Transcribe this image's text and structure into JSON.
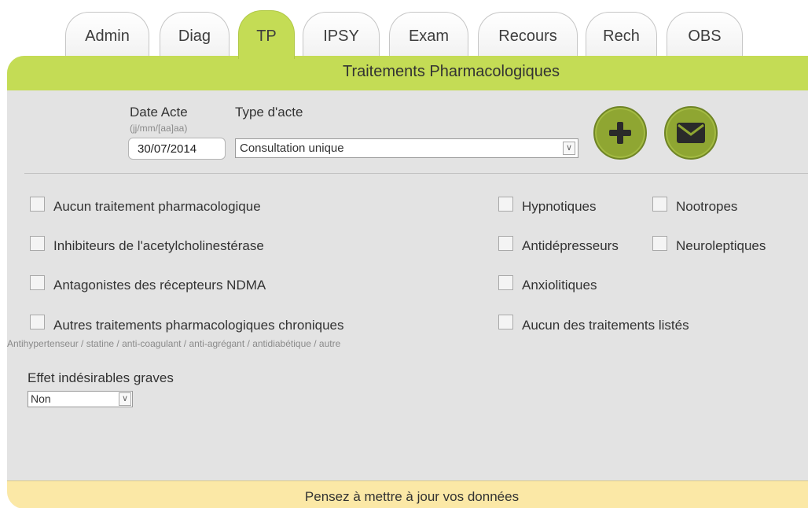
{
  "tabs": [
    {
      "label": "Admin"
    },
    {
      "label": "Diag"
    },
    {
      "label": "TP"
    },
    {
      "label": "IPSY"
    },
    {
      "label": "Exam"
    },
    {
      "label": "Recours"
    },
    {
      "label": "Rech"
    },
    {
      "label": "OBS"
    }
  ],
  "active_tab": "TP",
  "panel": {
    "title": "Traitements Pharmacologiques",
    "footer": "Pensez à mettre à jour vos données"
  },
  "form": {
    "date_label": "Date Acte",
    "date_hint": "(jj/mm/[aa]aa)",
    "date_value": "30/07/2014",
    "type_label": "Type d'acte",
    "type_value": "Consultation unique",
    "add_icon": "plus-icon",
    "mail_icon": "envelope-icon"
  },
  "checkboxes": {
    "aucun_traitement": "Aucun traitement pharmacologique",
    "inhibiteurs": "Inhibiteurs de l'acetylcholinestérase",
    "antagonistes": "Antagonistes des récepteurs NDMA",
    "autres": "Autres traitements pharmacologiques chroniques",
    "autres_hint": "Antihypertenseur / statine / anti-coagulant / anti-agrégant / antidiabétique / autre",
    "hypnotiques": "Hypnotiques",
    "nootropes": "Nootropes",
    "antidepresseurs": "Antidépresseurs",
    "neuroleptiques": "Neuroleptiques",
    "anxiolitiques": "Anxiolitiques",
    "aucun_listes": "Aucun des traitements listés"
  },
  "effets": {
    "label": "Effet indésirables graves",
    "value": "Non"
  },
  "colors": {
    "accent_green": "#c4dc55",
    "button_green": "#8fa632",
    "panel_gray": "#e3e3e3",
    "footer_yellow": "#fbe8a6"
  }
}
